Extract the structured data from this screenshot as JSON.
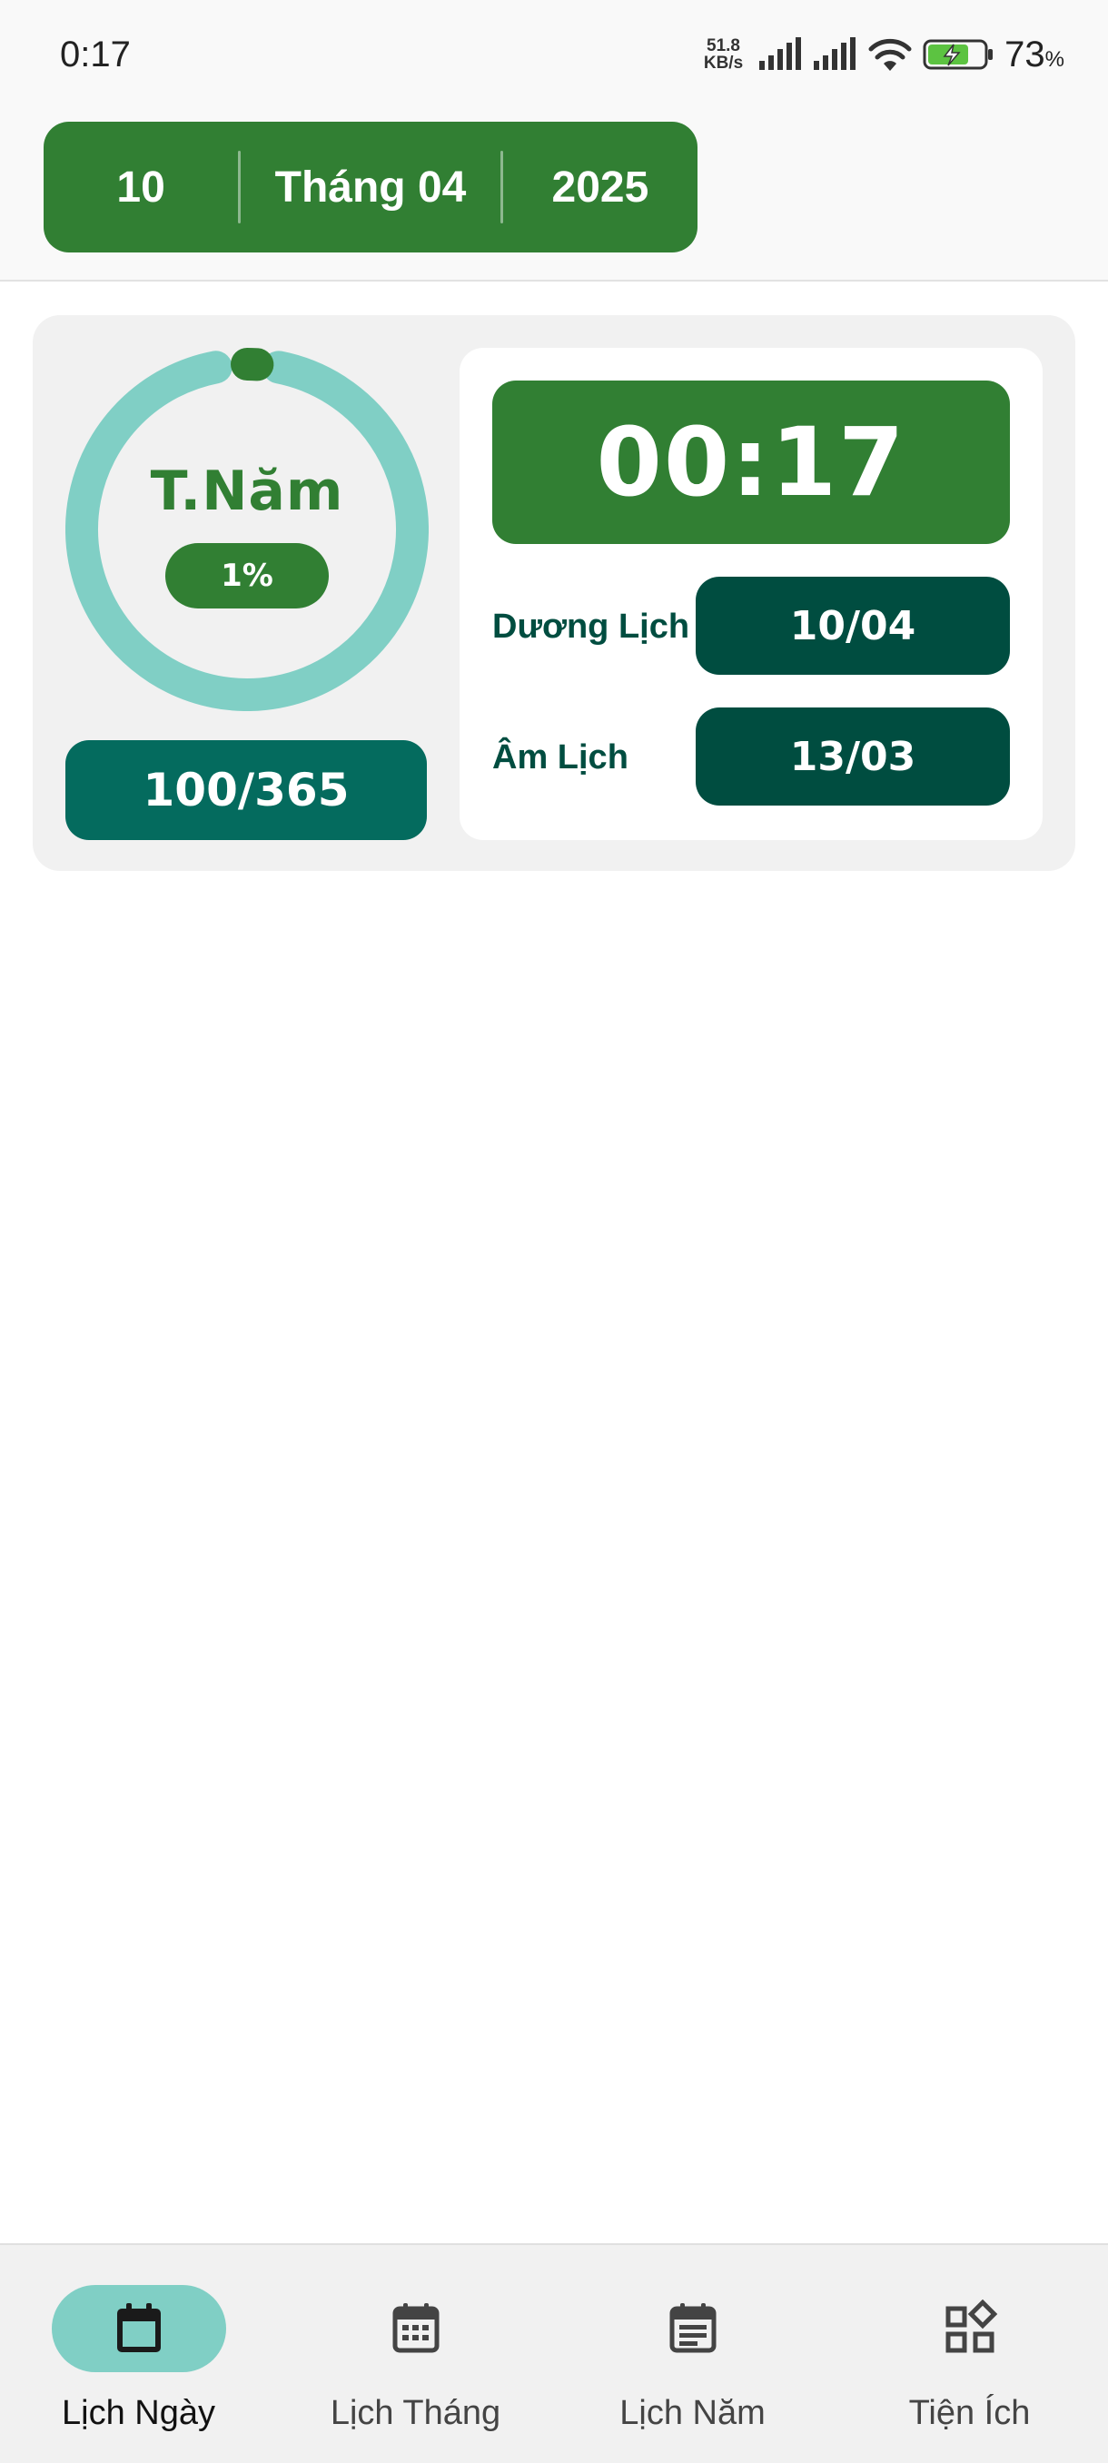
{
  "status_bar": {
    "time": "0:17",
    "net_speed_value": "51.8",
    "net_speed_unit": "KB/s",
    "battery_percent": "73",
    "battery_unit": "%"
  },
  "date_selector": {
    "day": "10",
    "month": "Tháng 04",
    "year": "2025"
  },
  "progress": {
    "label": "T.Năm",
    "percent_text": "1%",
    "fraction": 0.01,
    "day_count": "100/365",
    "ring_color": "#80cfc5",
    "progress_color": "#317f33"
  },
  "clock": {
    "time": "00:17"
  },
  "dates": {
    "solar_label": "Dương Lịch",
    "solar_value": "10/04",
    "lunar_label": "Âm Lịch",
    "lunar_value": "13/03"
  },
  "bottom_nav": {
    "items": [
      {
        "label": "Lịch Ngày",
        "icon": "calendar-today-icon",
        "active": true
      },
      {
        "label": "Lịch Tháng",
        "icon": "calendar-month-icon",
        "active": false
      },
      {
        "label": "Lịch Năm",
        "icon": "calendar-notes-icon",
        "active": false
      },
      {
        "label": "Tiện Ích",
        "icon": "widgets-icon",
        "active": false
      }
    ]
  },
  "colors": {
    "primary_green": "#317f33",
    "dark_teal": "#004d40",
    "teal": "#046b5e",
    "light_teal": "#80cfc5"
  }
}
